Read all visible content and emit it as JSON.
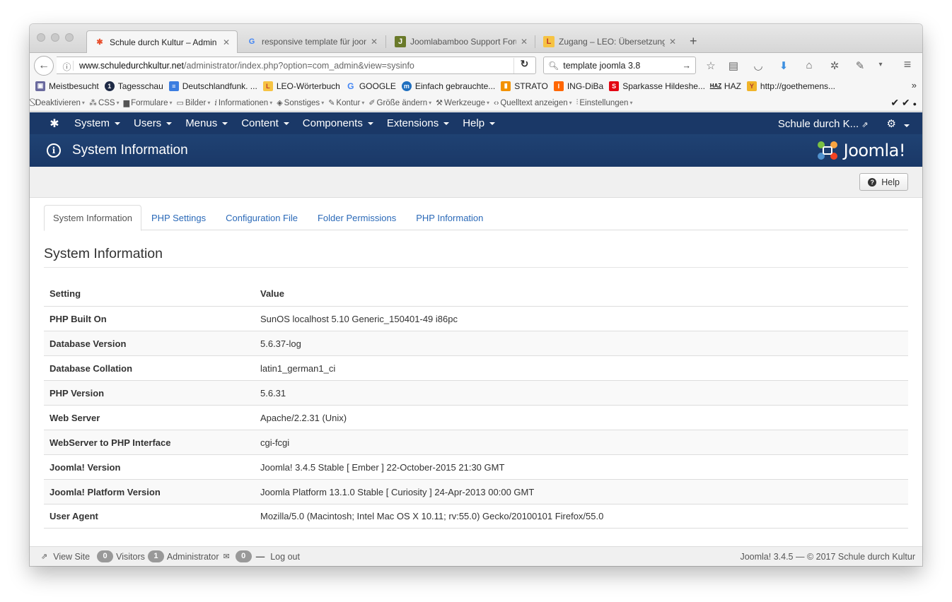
{
  "browser": {
    "tabs": [
      {
        "title": "Schule durch Kultur – Admin",
        "active": true
      },
      {
        "title": "responsive template für joon",
        "active": false
      },
      {
        "title": "Joomlabamboo Support Foru",
        "active": false
      },
      {
        "title": "Zugang – LEO: Übersetzung",
        "active": false
      }
    ],
    "new_tab": "+",
    "url_domain": "www.schuledurchkultur.net",
    "url_rest": "/administrator/index.php?option=com_admin&view=sysinfo",
    "search_value": "template joomla 3.8",
    "bookmarks": [
      "Meistbesucht",
      "Tagesschau",
      "Deutschlandfunk. ...",
      "LEO-Wörterbuch",
      "GOOGLE",
      "Einfach gebrauchte...",
      "STRATO",
      "ING-DiBa",
      "Sparkasse Hildeshe...",
      "HAZ",
      "http://goethemens..."
    ],
    "bookmarks_more": "»",
    "devtools": [
      "Deaktivieren",
      "CSS",
      "Formulare",
      "Bilder",
      "Informationen",
      "Sonstiges",
      "Kontur",
      "Größe ändern",
      "Werkzeuge",
      "Quelltext anzeigen",
      "Einstellungen"
    ]
  },
  "joomla": {
    "menu": [
      "System",
      "Users",
      "Menus",
      "Content",
      "Components",
      "Extensions",
      "Help"
    ],
    "site_link": "Schule durch K...",
    "page_title": "System Information",
    "brand": "Joomla!",
    "help_button": "Help",
    "tabs": [
      "System Information",
      "PHP Settings",
      "Configuration File",
      "Folder Permissions",
      "PHP Information"
    ],
    "section_title": "System Information",
    "table_header": {
      "setting": "Setting",
      "value": "Value"
    },
    "rows": [
      {
        "setting": "PHP Built On",
        "value": "SunOS localhost 5.10 Generic_150401-49 i86pc"
      },
      {
        "setting": "Database Version",
        "value": "5.6.37-log"
      },
      {
        "setting": "Database Collation",
        "value": "latin1_german1_ci"
      },
      {
        "setting": "PHP Version",
        "value": "5.6.31"
      },
      {
        "setting": "Web Server",
        "value": "Apache/2.2.31 (Unix)"
      },
      {
        "setting": "WebServer to PHP Interface",
        "value": "cgi-fcgi"
      },
      {
        "setting": "Joomla! Version",
        "value": "Joomla! 3.4.5 Stable [ Ember ] 22-October-2015 21:30 GMT"
      },
      {
        "setting": "Joomla! Platform Version",
        "value": "Joomla Platform 13.1.0 Stable [ Curiosity ] 24-Apr-2013 00:00 GMT"
      },
      {
        "setting": "User Agent",
        "value": "Mozilla/5.0 (Macintosh; Intel Mac OS X 10.11; rv:55.0) Gecko/20100101 Firefox/55.0"
      }
    ],
    "footer": {
      "view_site": "View Site",
      "visitors_count": "0",
      "visitors_label": "Visitors",
      "admin_count": "1",
      "admin_label": "Administrator",
      "messages_count": "0",
      "logout": "Log out",
      "right_text": "Joomla! 3.4.5  —  © 2017 Schule durch Kultur"
    }
  },
  "colors": {
    "nav_bg": "#1a3867",
    "link": "#2a69b8"
  }
}
